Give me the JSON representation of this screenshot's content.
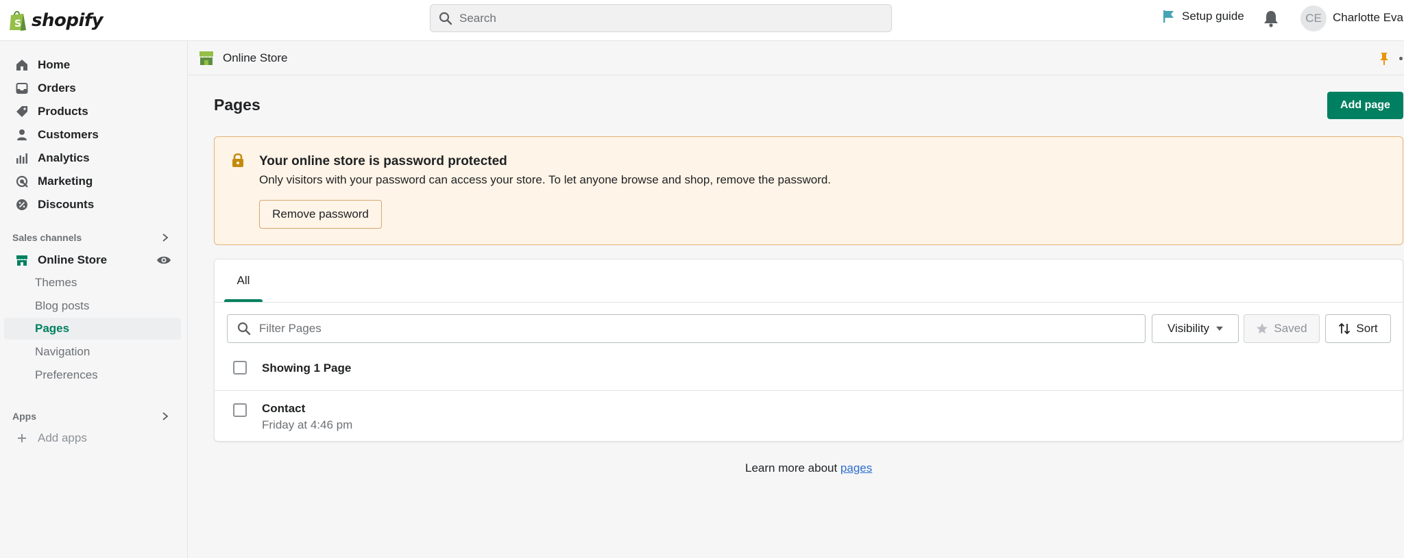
{
  "topbar": {
    "logo_text": "shopify",
    "search_placeholder": "Search",
    "setup_guide": "Setup guide",
    "avatar_initials": "CE",
    "user_name": "Charlotte Eva"
  },
  "sidebar": {
    "items": [
      {
        "label": "Home",
        "icon": "home-icon"
      },
      {
        "label": "Orders",
        "icon": "orders-icon"
      },
      {
        "label": "Products",
        "icon": "tag-icon"
      },
      {
        "label": "Customers",
        "icon": "person-icon"
      },
      {
        "label": "Analytics",
        "icon": "bar-chart-icon"
      },
      {
        "label": "Marketing",
        "icon": "target-icon"
      },
      {
        "label": "Discounts",
        "icon": "discount-icon"
      }
    ],
    "sales_channels_label": "Sales channels",
    "online_store": "Online Store",
    "online_store_subitems": [
      "Themes",
      "Blog posts",
      "Pages",
      "Navigation",
      "Preferences"
    ],
    "active_subitem": "Pages",
    "apps_label": "Apps",
    "add_apps": "Add apps"
  },
  "breadcrumb": {
    "label": "Online Store"
  },
  "page": {
    "title": "Pages",
    "add_button": "Add page"
  },
  "banner": {
    "title": "Your online store is password protected",
    "description": "Only visitors with your password can access your store. To let anyone browse and shop, remove the password.",
    "button": "Remove password"
  },
  "list": {
    "tab_all": "All",
    "filter_placeholder": "Filter Pages",
    "visibility": "Visibility",
    "saved": "Saved",
    "sort": "Sort",
    "showing": "Showing 1 Page",
    "rows": [
      {
        "title": "Contact",
        "updated": "Friday at 4:46 pm"
      }
    ]
  },
  "footer": {
    "learn_prefix": "Learn more about ",
    "learn_link": "pages"
  },
  "colors": {
    "accent": "#008060",
    "banner_bg": "#fff4e8",
    "banner_border": "#e5b476",
    "link": "#2c6ecb"
  }
}
